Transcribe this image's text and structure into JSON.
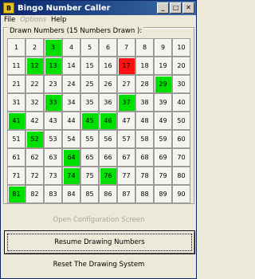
{
  "window": {
    "title": "Bingo Number Caller",
    "icon": "bingo-app-icon"
  },
  "menu": [
    {
      "label": "File",
      "enabled": true
    },
    {
      "label": "Options",
      "enabled": false
    },
    {
      "label": "Help",
      "enabled": true
    }
  ],
  "group": {
    "label": "Drawn Numbers (15 Numbers Drawn ):"
  },
  "numbers": {
    "min": 1,
    "max": 90,
    "columns": 10,
    "drawn": [
      3,
      12,
      13,
      29,
      33,
      37,
      41,
      45,
      46,
      52,
      64,
      74,
      76,
      81
    ],
    "last_drawn": 17
  },
  "colors": {
    "drawn": "#00e000",
    "last_drawn": "#ff1010"
  },
  "buttons": {
    "open_config": "Open Configuration Screen",
    "resume": "Resume Drawing Numbers",
    "reset": "Reset The Drawing System"
  }
}
